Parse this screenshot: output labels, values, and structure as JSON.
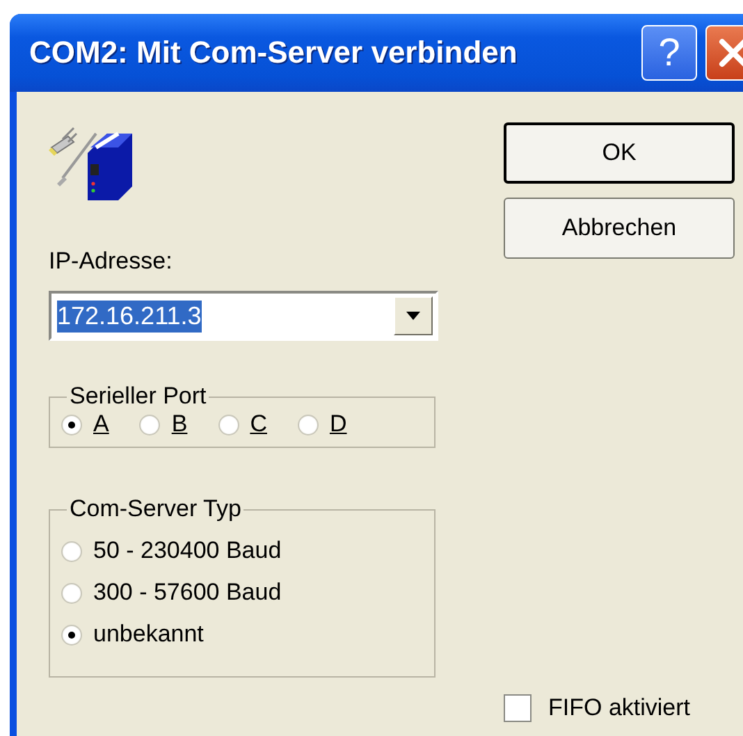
{
  "window": {
    "title": "COM2: Mit Com-Server verbinden",
    "help_button": "?"
  },
  "ip_address": {
    "label": "IP-Adresse:",
    "value": "172.16.211.3"
  },
  "serial_port": {
    "label": "Serieller Port",
    "options": [
      {
        "label": "A",
        "selected": true
      },
      {
        "label": "B",
        "selected": false
      },
      {
        "label": "C",
        "selected": false
      },
      {
        "label": "D",
        "selected": false
      }
    ]
  },
  "server_type": {
    "label": "Com-Server Typ",
    "options": [
      {
        "label": "50 - 230400 Baud",
        "selected": false
      },
      {
        "label": "300 - 57600 Baud",
        "selected": false
      },
      {
        "label": "unbekannt",
        "selected": true
      }
    ]
  },
  "buttons": [
    {
      "label": "OK",
      "default": true
    },
    {
      "label": "Abbrechen",
      "default": false
    }
  ],
  "fifo": {
    "label": "FIFO aktiviert",
    "checked": false
  }
}
